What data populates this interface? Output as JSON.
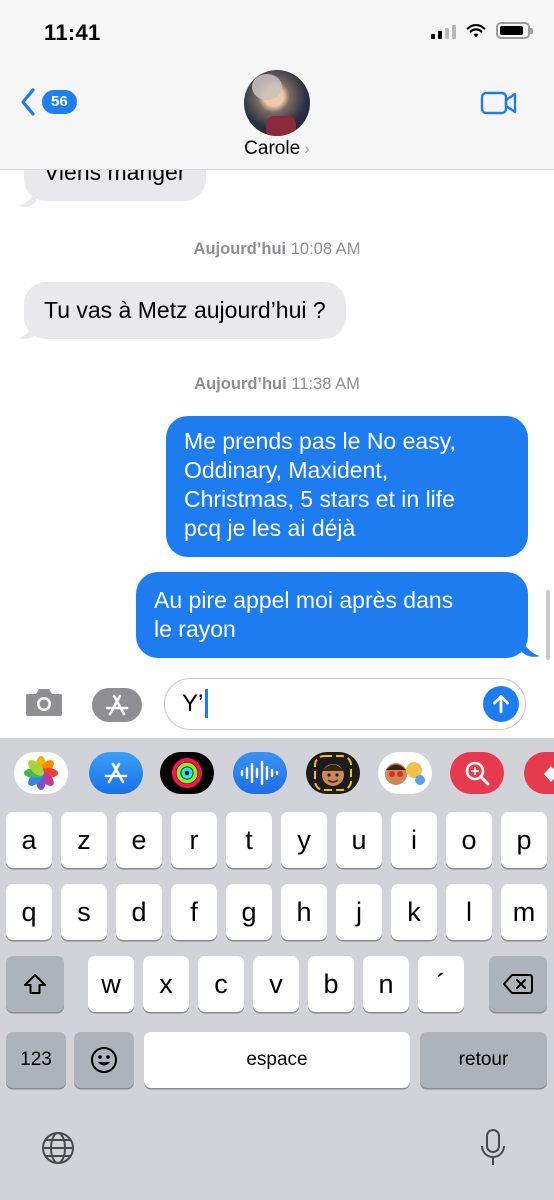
{
  "status_bar": {
    "time": "11:41",
    "battery_level": 0.9
  },
  "header": {
    "back_badge": "56",
    "contact_name": "Carole",
    "chevron": "›"
  },
  "messages": {
    "partial_top": "Viens manger",
    "stamp1": {
      "day": "Aujourd’hui",
      "time": "10:08 AM"
    },
    "incoming1": "Tu vas à Metz aujourd’hui ?",
    "stamp2": {
      "day": "Aujourd’hui",
      "time": "11:38 AM"
    },
    "out1_lines": [
      "Me prends pas le No easy,",
      "Oddinary, Maxident,",
      "Christmas, 5 stars et in life",
      "pcq je les ai déjà"
    ],
    "out2_lines": [
      "Au pire appel moi après dans",
      "le rayon"
    ]
  },
  "input": {
    "value": "Y’"
  },
  "keyboard": {
    "row1": [
      "a",
      "z",
      "e",
      "r",
      "t",
      "y",
      "u",
      "i",
      "o",
      "p"
    ],
    "row2": [
      "q",
      "s",
      "d",
      "f",
      "g",
      "h",
      "j",
      "k",
      "l",
      "m"
    ],
    "row3": [
      "w",
      "x",
      "c",
      "v",
      "b",
      "n",
      "´"
    ],
    "numbers_label": "123",
    "space_label": "espace",
    "return_label": "retour"
  },
  "icons": [
    "camera-icon",
    "app-store-icon",
    "send-arrow-icon",
    "video-camera-icon",
    "globe-icon",
    "microphone-icon",
    "shift-icon",
    "delete-icon",
    "emoji-icon"
  ],
  "colors": {
    "accent": "#1e7cf1",
    "incoming_bubble": "#e9e9eb",
    "keyboard_bg": "#d1d3d9"
  }
}
